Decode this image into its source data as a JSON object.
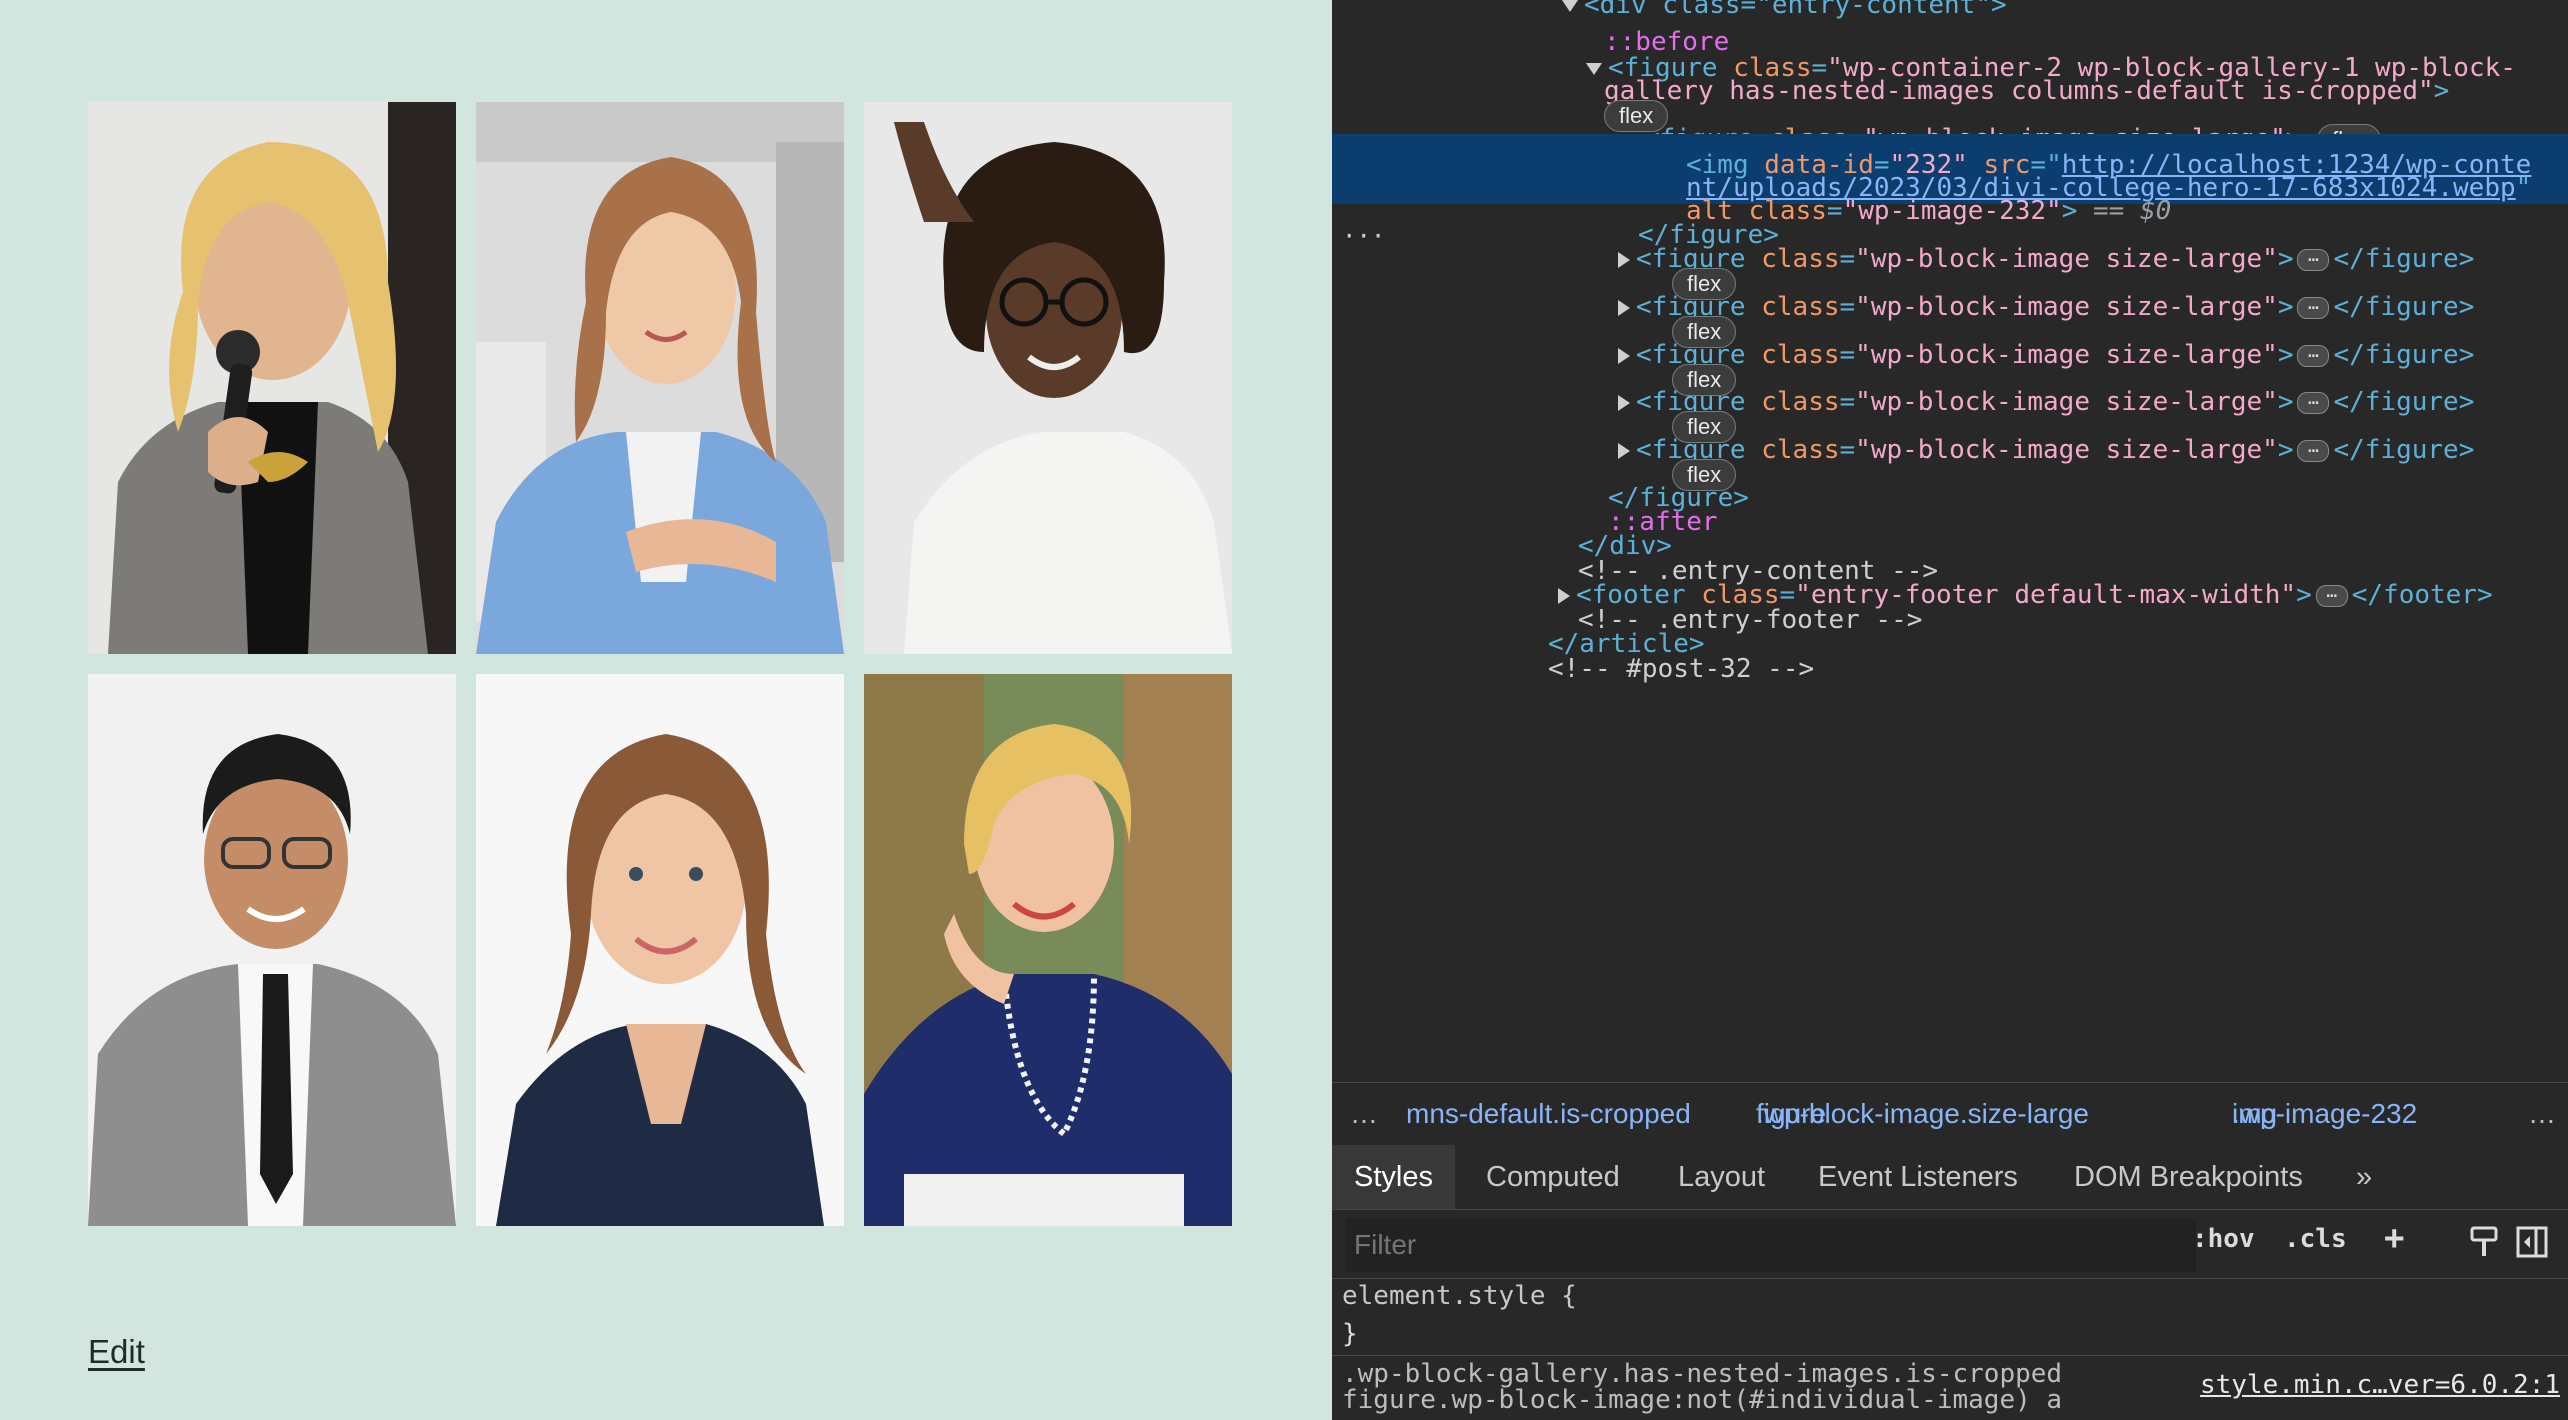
{
  "page": {
    "background_color": "#d2e5df",
    "edit_label": "Edit",
    "gallery": [
      {
        "name": "woman-with-microphone-photo",
        "bg": "#e6e6e4"
      },
      {
        "name": "woman-in-blue-blazer-photo",
        "bg": "#dcdcdc"
      },
      {
        "name": "woman-with-glasses-photo",
        "bg": "#e8e8e8"
      },
      {
        "name": "man-in-gray-suit-photo",
        "bg": "#f1f1f1"
      },
      {
        "name": "smiling-woman-portrait-photo",
        "bg": "#f7f7f7"
      },
      {
        "name": "blonde-woman-pearl-necklace-photo",
        "bg": "#7a8b5a"
      }
    ]
  },
  "devtools": {
    "dom": {
      "l0": "<div class=\"entry-content\">",
      "before": "::before",
      "figure_open_tag": "figure",
      "figure_class_attr": "class",
      "figure_class_val": "\"wp-container-2 wp-block-gallery-1 wp-block-",
      "figure_class_val2": "gallery has-nested-images columns-default is-cropped\"",
      "flex": "flex",
      "inner_tag": "figure",
      "inner_class_attr": "class",
      "inner_class_val": "\"wp-block-image size-large\"",
      "img_tag": "img",
      "img_attr_dataid": "data-id",
      "img_dataid_val": "\"232\"",
      "img_attr_src": "src",
      "img_src_1": "http://localhost:1234/wp-conte",
      "img_src_2": "nt/uploads/2023/03/divi-college-hero-17-683x1024.webp",
      "img_attr_alt": "alt",
      "img_attr_class": "class",
      "img_class_val": "\"wp-image-232\"",
      "eq": "== ",
      "dollar": "$0",
      "close_figure": "</figure>",
      "after": "::after",
      "close_div": "</div>",
      "comment_entry": "<!-- .entry-content -->",
      "footer_tag": "footer",
      "footer_class_val": "\"entry-footer default-max-width\"",
      "close_footer": "</footer>",
      "comment_footer": "<!-- .entry-footer -->",
      "close_article": "</article>",
      "comment_post": "<!-- #post-32 -->",
      "ellipsis": "…"
    },
    "breadcrumbs": {
      "more_left": "…",
      "c1": "mns-default.is-cropped",
      "c2_tag": "figure",
      "c2_cls": ".wp-block-image.size-large",
      "c3_tag": "img",
      "c3_cls": ".wp-image-232",
      "more_right": "…"
    },
    "tabs": {
      "styles": "Styles",
      "computed": "Computed",
      "layout": "Layout",
      "event_listeners": "Event Listeners",
      "dom_breakpoints": "DOM Breakpoints",
      "more": "»"
    },
    "filter": {
      "placeholder": "Filter",
      "hov": ":hov",
      "cls": ".cls",
      "plus": "+"
    },
    "styles": {
      "element_style": "element.style {",
      "close_brace": "}",
      "rule_selector_1": ".wp-block-gallery.has-nested-images.is-cropped",
      "rule_selector_2": "figure.wp-block-image:not(#individual-image) a",
      "source": "style.min.c…ver=6.0.2:1"
    },
    "colors": {
      "panel_bg": "#282828",
      "selected_row": "#0b3d6e",
      "tag": "#5db0d7",
      "attr_name": "#f29766",
      "attr_value": "#f4a9ca"
    }
  }
}
